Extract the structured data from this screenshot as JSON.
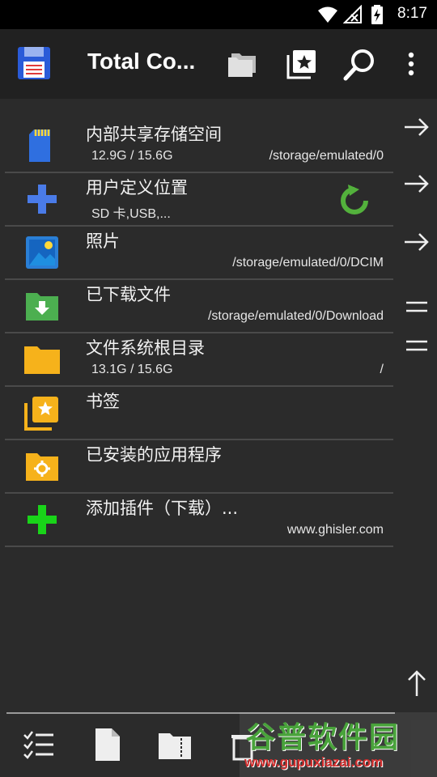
{
  "status_bar": {
    "time": "8:17"
  },
  "app_bar": {
    "title": "Total Co..."
  },
  "items": [
    {
      "name": "内部共享存储空间",
      "sub": "12.9G / 15.6G",
      "path": "/storage/emulated/0"
    },
    {
      "name": "用户定义位置",
      "sub": "SD 卡,USB,...",
      "path": ""
    },
    {
      "name": "照片",
      "sub": "",
      "path": "/storage/emulated/0/DCIM"
    },
    {
      "name": "已下载文件",
      "sub": "",
      "path": "/storage/emulated/0/Download"
    },
    {
      "name": "文件系统根目录",
      "sub": "13.1G / 15.6G",
      "path": "/"
    },
    {
      "name": "书签",
      "sub": "",
      "path": ""
    },
    {
      "name": "已安装的应用程序",
      "sub": "",
      "path": ""
    },
    {
      "name": "添加插件（下载）...",
      "sub": "",
      "path": "www.ghisler.com"
    }
  ],
  "watermark": {
    "line1": "谷普软件园",
    "line2": "www.gupuxiazai.com"
  },
  "colors": {
    "background": "#2b2b2b",
    "appbar": "#212121",
    "statusbar": "#000000",
    "folder": "#f6b21b",
    "green": "#4caf50",
    "blue": "#2a6fd6"
  }
}
